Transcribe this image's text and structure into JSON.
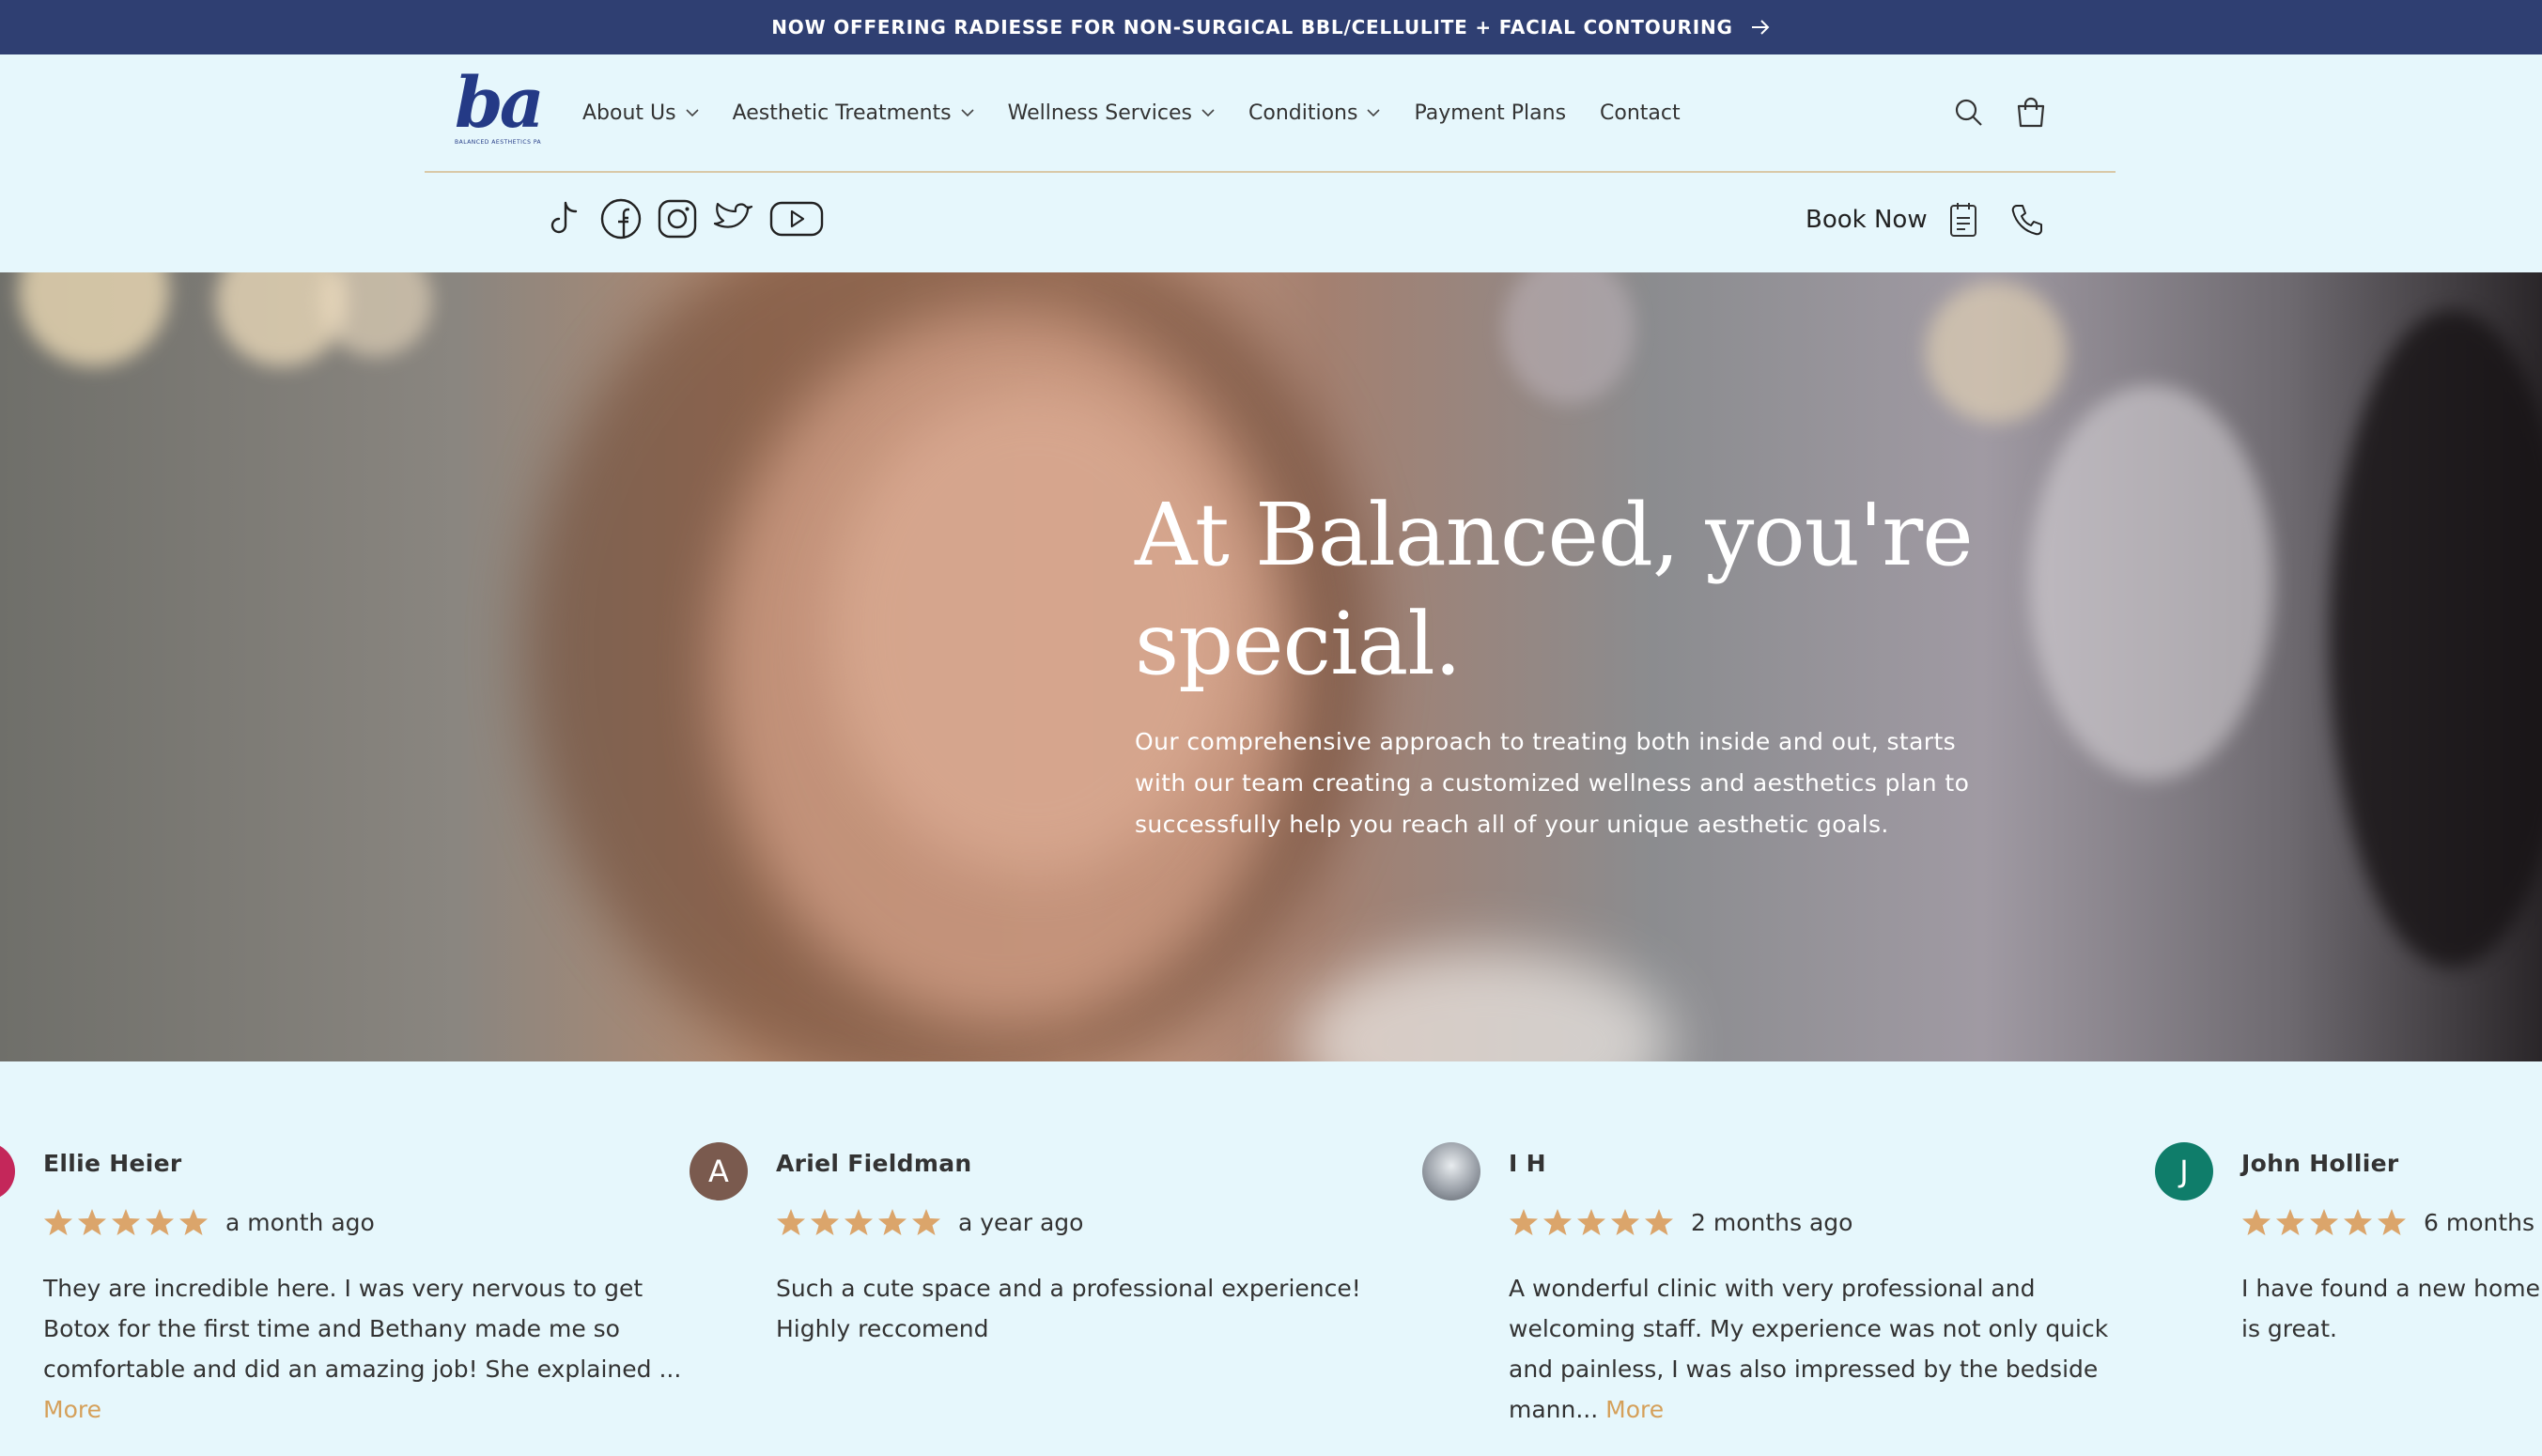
{
  "announcement": {
    "text": "NOW OFFERING RADIESSE FOR NON-SURGICAL BBL/CELLULITE + FACIAL CONTOURING"
  },
  "logo": {
    "mark": "ba",
    "tagline": "BALANCED AESTHETICS PA"
  },
  "nav": {
    "items": [
      {
        "label": "About Us",
        "dropdown": true
      },
      {
        "label": "Aesthetic Treatments",
        "dropdown": true
      },
      {
        "label": "Wellness Services",
        "dropdown": true
      },
      {
        "label": "Conditions",
        "dropdown": true
      },
      {
        "label": "Payment Plans",
        "dropdown": false
      },
      {
        "label": "Contact",
        "dropdown": false
      }
    ]
  },
  "social": [
    "tiktok-icon",
    "facebook-icon",
    "instagram-icon",
    "twitter-icon",
    "youtube-icon"
  ],
  "book": {
    "label": "Book Now"
  },
  "hero": {
    "title_line1": "At Balanced, you're",
    "title_line2": "special.",
    "subtitle": "Our comprehensive approach to treating both inside and out, starts with our team creating a customized wellness and aesthetics plan to successfully help you reach all of your unique aesthetic goals."
  },
  "reviews": [
    {
      "name": "Ellie Heier",
      "when": "a month ago",
      "rating": 5,
      "avatar_letter": "",
      "avatar_color": "#c4275a",
      "text": "They are incredible here. I was very nervous to get Botox for the first time and Bethany made me so comfortable and did an amazing job! She explained ...",
      "more": "More"
    },
    {
      "name": "Ariel Fieldman",
      "when": "a year ago",
      "rating": 5,
      "avatar_letter": "A",
      "avatar_color": "#7a5a4e",
      "text": "Such a cute space and a professional experience! Highly reccomend",
      "more": ""
    },
    {
      "name": "I H",
      "when": "2 months ago",
      "rating": 5,
      "avatar_letter": "",
      "avatar_color": "#8a8f96",
      "text": "A wonderful clinic with very professional and welcoming staff. My experience was not only quick and painless, I was also impressed by the bedside mann...",
      "more": "More"
    },
    {
      "name": "John Hollier",
      "when": "6 months",
      "rating": 5,
      "avatar_letter": "J",
      "avatar_color": "#0f7d6a",
      "text": "I have found a new home is great.",
      "more": ""
    }
  ],
  "colors": {
    "announce_bg": "#2f3f72",
    "page_bg": "#e6f7fc",
    "star": "#dba56b",
    "more_link": "#d5a05a",
    "logo": "#243a86"
  }
}
